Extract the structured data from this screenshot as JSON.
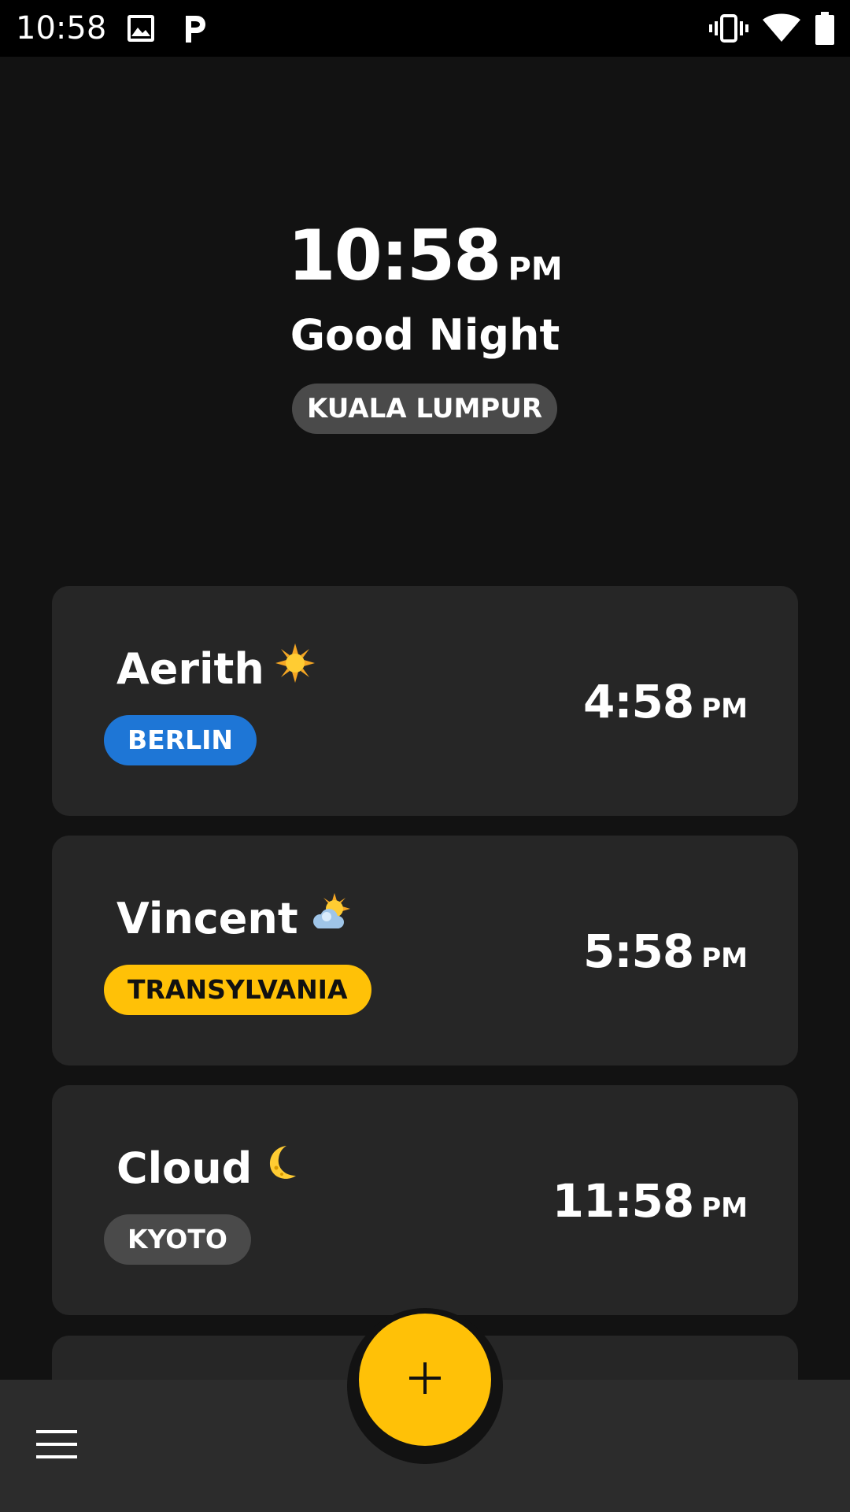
{
  "status_bar": {
    "time": "10:58",
    "icons": [
      "image-icon",
      "p-app-icon",
      "vibrate-icon",
      "wifi-icon",
      "battery-icon"
    ]
  },
  "header": {
    "time": "10:58",
    "ampm": "PM",
    "greeting": "Good Night",
    "city": "KUALA LUMPUR"
  },
  "cards": [
    {
      "name": "Aerith",
      "icon": "sun-icon",
      "city": "BERLIN",
      "city_bg": "#1e76d6",
      "city_color": "#ffffff",
      "time": "4:58",
      "ampm": "PM"
    },
    {
      "name": "Vincent",
      "icon": "sun-behind-cloud-icon",
      "city": "TRANSYLVANIA",
      "city_bg": "#ffc107",
      "city_color": "#111111",
      "time": "5:58",
      "ampm": "PM"
    },
    {
      "name": "Cloud",
      "icon": "crescent-moon-icon",
      "city": "KYOTO",
      "city_bg": "#4a4a4a",
      "city_color": "#ffffff",
      "time": "11:58",
      "ampm": "PM"
    }
  ],
  "colors": {
    "background": "#121212",
    "card": "#262626",
    "accent": "#ffc107",
    "bottom_bar": "#2c2c2c"
  },
  "bottom_bar": {
    "menu_icon": "hamburger-menu-icon",
    "fab_icon": "plus-icon"
  }
}
